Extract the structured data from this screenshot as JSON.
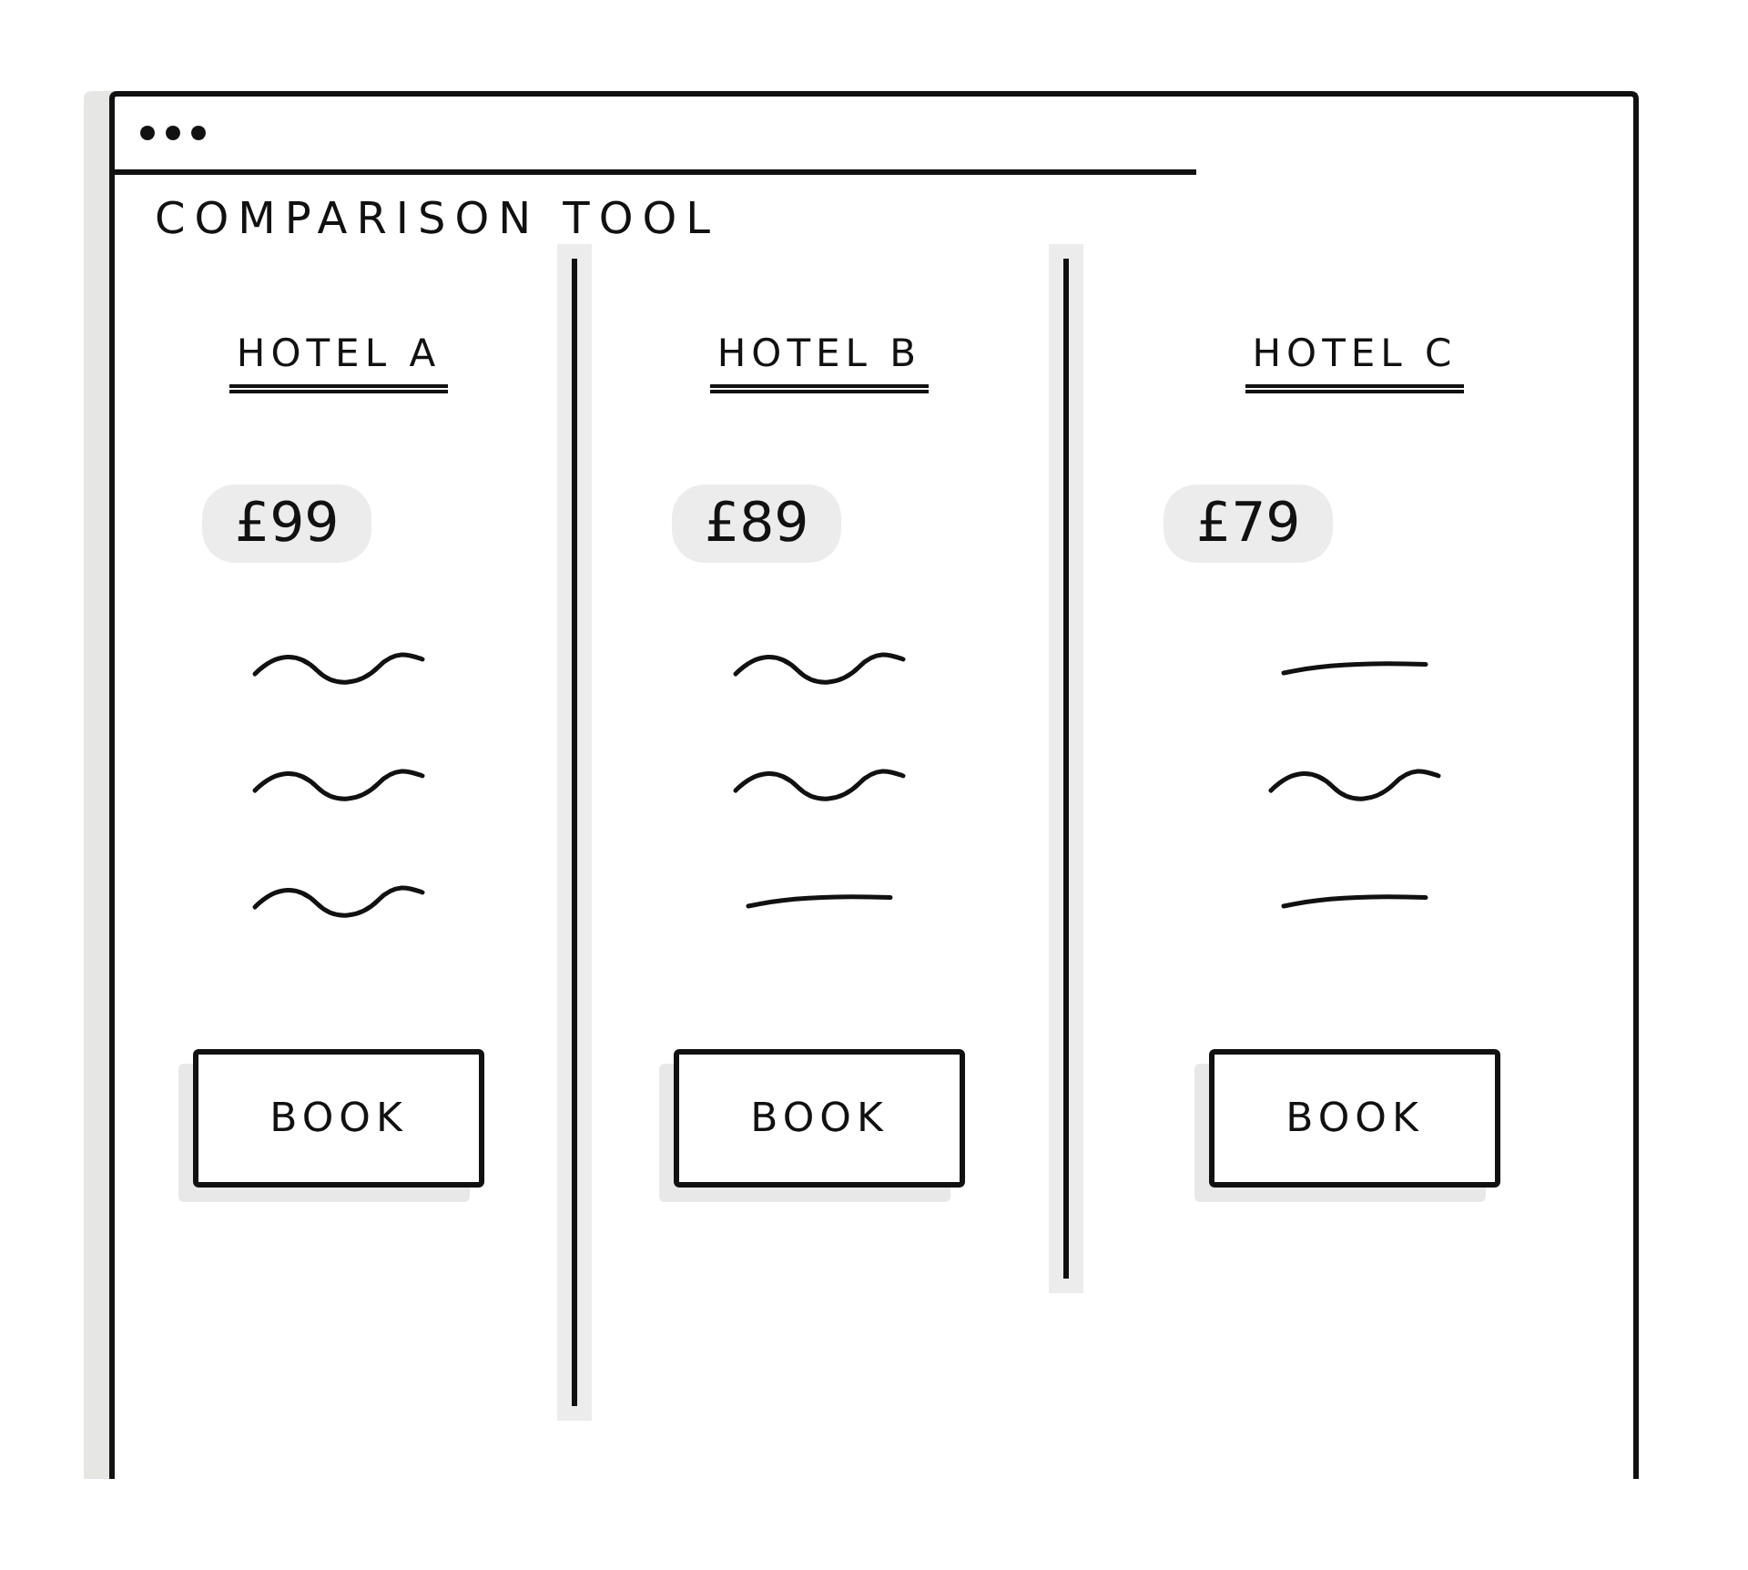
{
  "heading": "COMPARISON TOOL",
  "hotels": [
    {
      "name": "HOTEL A",
      "price": "£99",
      "details": [
        {
          "kind": "wave"
        },
        {
          "kind": "wave"
        },
        {
          "kind": "wave"
        }
      ],
      "button": "BOOK"
    },
    {
      "name": "HOTEL B",
      "price": "£89",
      "details": [
        {
          "kind": "wave"
        },
        {
          "kind": "wave"
        },
        {
          "kind": "dash"
        }
      ],
      "button": "BOOK"
    },
    {
      "name": "HOTEL C",
      "price": "£79",
      "details": [
        {
          "kind": "dash"
        },
        {
          "kind": "wave"
        },
        {
          "kind": "dash"
        }
      ],
      "button": "BOOK"
    }
  ]
}
